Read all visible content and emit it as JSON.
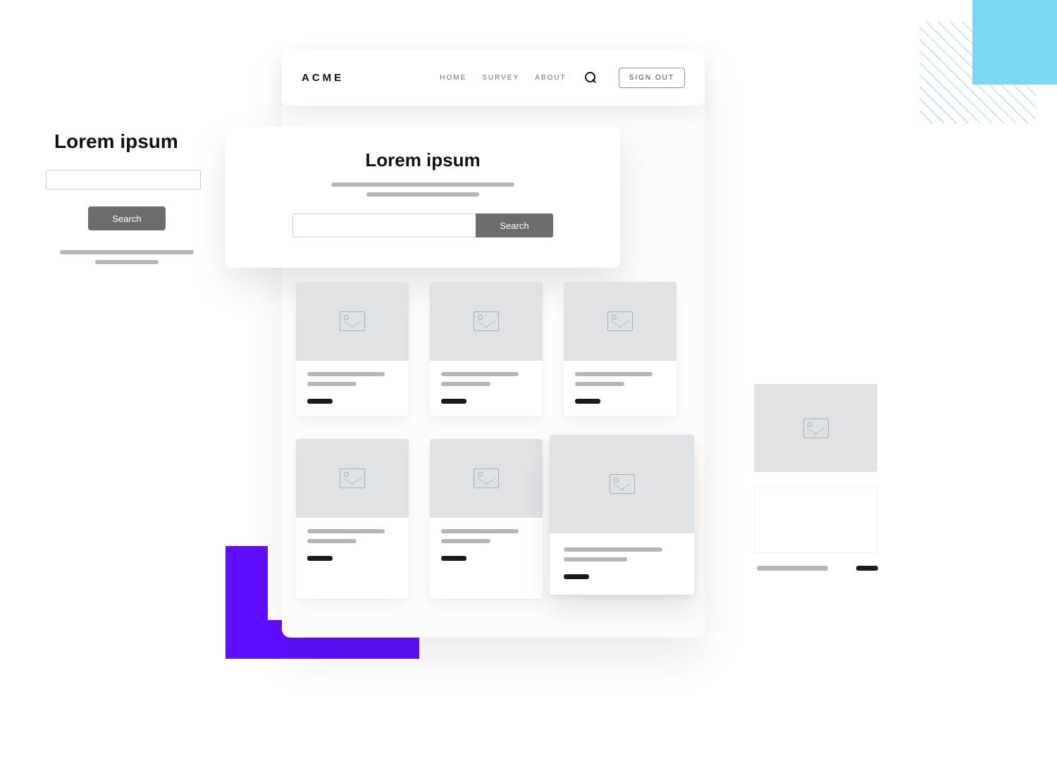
{
  "header": {
    "brand": "ACME",
    "nav": [
      "HOME",
      "SURVEY",
      "ABOUT"
    ],
    "signout": "SIGN OUT"
  },
  "search_card": {
    "title": "Lorem ipsum",
    "button": "Search"
  },
  "left_panel": {
    "title": "Lorem ipsum",
    "button": "Search"
  }
}
